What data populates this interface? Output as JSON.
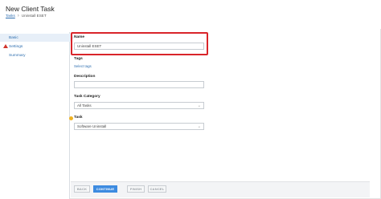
{
  "header": {
    "title": "New Client Task",
    "breadcrumb": {
      "root": "Tasks",
      "current": "Uninstall ESET"
    }
  },
  "sidebar": {
    "items": [
      {
        "label": "Basic",
        "active": true,
        "warning": false
      },
      {
        "label": "Settings",
        "active": false,
        "warning": true
      },
      {
        "label": "Summary",
        "active": false,
        "warning": false
      }
    ]
  },
  "form": {
    "name": {
      "label": "Name",
      "value": "Uninstall ESET"
    },
    "tags": {
      "label": "Tags",
      "link": "Select tags"
    },
    "description": {
      "label": "Description",
      "value": ""
    },
    "category": {
      "label": "Task Category",
      "value": "All Tasks"
    },
    "task": {
      "label": "Task",
      "value": "Software Uninstall"
    }
  },
  "footer": {
    "back": "BACK",
    "continue": "CONTINUE",
    "finish": "FINISH",
    "cancel": "CANCEL"
  },
  "colors": {
    "accent": "#3d8be0",
    "highlight": "#d9252a",
    "warning": "#d0342c"
  }
}
